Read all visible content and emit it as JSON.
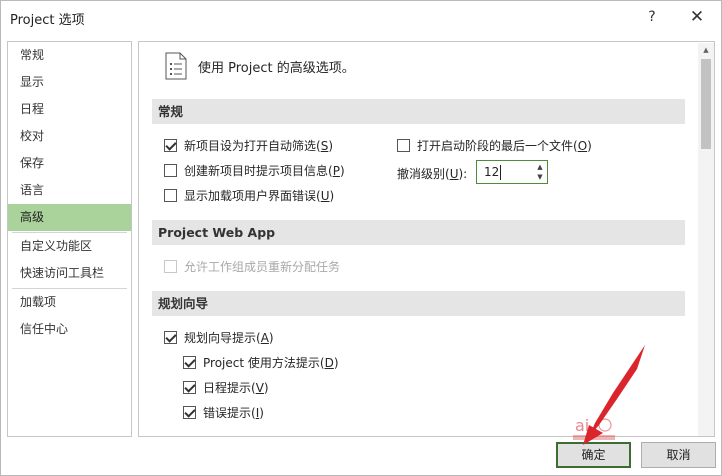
{
  "window": {
    "title": "Project 选项",
    "help_icon": "?",
    "close_icon": "✕"
  },
  "nav": {
    "items": [
      {
        "label": "常规"
      },
      {
        "label": "显示"
      },
      {
        "label": "日程"
      },
      {
        "label": "校对"
      },
      {
        "label": "保存"
      },
      {
        "label": "语言"
      },
      {
        "label": "高级",
        "selected": true
      },
      {
        "label": "自定义功能区"
      },
      {
        "label": "快速访问工具栏"
      },
      {
        "label": "加载项"
      },
      {
        "label": "信任中心"
      }
    ]
  },
  "content": {
    "header_text": "使用 Project 的高级选项。",
    "sections": {
      "general": {
        "title": "常规",
        "options": {
          "auto_filter": {
            "label": "新项目设为打开自动筛选(",
            "key": "S",
            "close": ")",
            "checked": true
          },
          "prompt_info": {
            "label": "创建新项目时提示项目信息(",
            "key": "P",
            "close": ")",
            "checked": false
          },
          "addin_errors": {
            "label": "显示加载项用户界面错误(",
            "key": "U",
            "close": ")",
            "checked": false
          },
          "open_last": {
            "label": "打开启动阶段的最后一个文件(",
            "key": "O",
            "close": ")",
            "checked": false
          }
        },
        "undo": {
          "label": "撤消级别(",
          "key": "U",
          "close": "):",
          "value": "12"
        }
      },
      "pwa": {
        "title": "Project Web App",
        "options": {
          "reassign": {
            "label": "允许工作组成员重新分配任务",
            "checked": false,
            "disabled": true
          }
        }
      },
      "planning": {
        "title": "规划向导",
        "options": {
          "wizard": {
            "label": "规划向导提示(",
            "key": "A",
            "close": ")",
            "checked": true
          },
          "usage": {
            "label": "Project 使用方法提示(",
            "key": "D",
            "close": ")",
            "checked": true
          },
          "schedule": {
            "label": "日程提示(",
            "key": "V",
            "close": ")",
            "checked": true
          },
          "errors": {
            "label": "错误提示(",
            "key": "I",
            "close": ")",
            "checked": true
          }
        }
      }
    }
  },
  "buttons": {
    "ok": "确定",
    "cancel": "取消"
  },
  "colors": {
    "selected_nav": "#a9d39a",
    "focus_border": "#3c6d32",
    "annotation": "#d9252b"
  },
  "icons": {
    "header": "document-list-icon",
    "scroll_up": "chevron-up-icon"
  }
}
